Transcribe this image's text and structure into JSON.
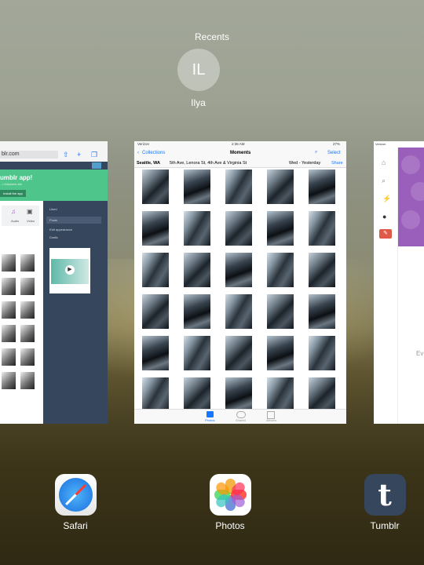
{
  "recents": {
    "label": "Recents",
    "contact_initials": "IL",
    "contact_name": "Ilya"
  },
  "safari_card": {
    "url": "blr.com",
    "banner_text": "umblr app!",
    "banner_sub": "...t followers ste",
    "banner_button": "Install the app",
    "menu_items": [
      "Liked",
      "Posts",
      "Edit appearance",
      "Drafts"
    ],
    "video_labels": [
      "Audio",
      "Video"
    ]
  },
  "photos_card": {
    "carrier": "Verizon",
    "time": "2:36 AM",
    "battery": "27%",
    "back_label": "Collections",
    "title": "Moments",
    "select_label": "Select",
    "location": "Seattle, WA",
    "streets": "5th Ave, Lenora St, 4th Ave & Virginia St",
    "date_range": "Wed - Yesterday",
    "share_label": "Share",
    "tabs": [
      "Photos",
      "Shared",
      "Albums"
    ]
  },
  "tumblr_card": {
    "carrier": "Verizon",
    "partial_text": "Ev"
  },
  "dock_apps": [
    {
      "label": "Safari",
      "icon": "safari-compass-icon"
    },
    {
      "label": "Photos",
      "icon": "photos-flower-icon"
    },
    {
      "label": "Tumblr",
      "icon": "tumblr-t-icon"
    }
  ],
  "colors": {
    "tumblr_navy": "#36465d",
    "tumblr_green": "#4ec58b",
    "ios_blue": "#1677ff"
  }
}
